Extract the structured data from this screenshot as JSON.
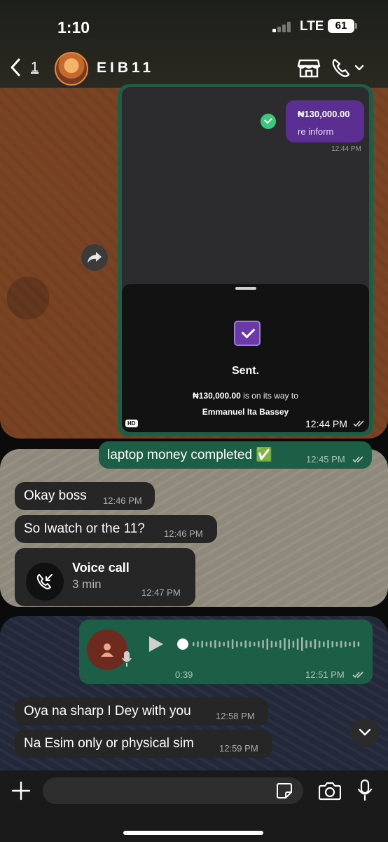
{
  "status_bar": {
    "time": "1:10",
    "network": "LTE",
    "battery": "61"
  },
  "header": {
    "back_count": "1",
    "chat_name": "EIB11"
  },
  "forwarded_image": {
    "inner_amount": "₦130,000.00",
    "inner_note": "re inform",
    "inner_time": "12:44 PM",
    "sent_title": "Sent.",
    "sent_amount": "₦130,000.00",
    "sent_text": " is on its way to",
    "recipient": "Emmanuel Ita Bassey",
    "hd_badge": "HD",
    "time": "12:44 PM"
  },
  "messages": [
    {
      "id": "m1",
      "direction": "out",
      "text": "laptop money completed ✅",
      "time": "12:45 PM"
    },
    {
      "id": "m2",
      "direction": "in",
      "text": "Okay boss",
      "time": "12:46 PM"
    },
    {
      "id": "m3",
      "direction": "in",
      "text": "So Iwatch or the 11?",
      "time": "12:46 PM"
    },
    {
      "id": "m4",
      "direction": "in",
      "type": "call",
      "title": "Voice call",
      "duration": "3 min",
      "time": "12:47 PM"
    },
    {
      "id": "m5",
      "direction": "out",
      "type": "voice",
      "duration": "0:39",
      "time": "12:51 PM"
    },
    {
      "id": "m6",
      "direction": "in",
      "text": "Oya na sharp I Dey with you",
      "time": "12:58 PM"
    },
    {
      "id": "m7",
      "direction": "in",
      "text": "Na Esim only or physical sim",
      "time": "12:59 PM"
    }
  ],
  "composer": {
    "placeholder": ""
  },
  "colors": {
    "outgoing": "#1d5e46",
    "incoming": "#262626",
    "accent_purple": "#5b2f91",
    "wallpaper_brown": "#7a4424"
  }
}
